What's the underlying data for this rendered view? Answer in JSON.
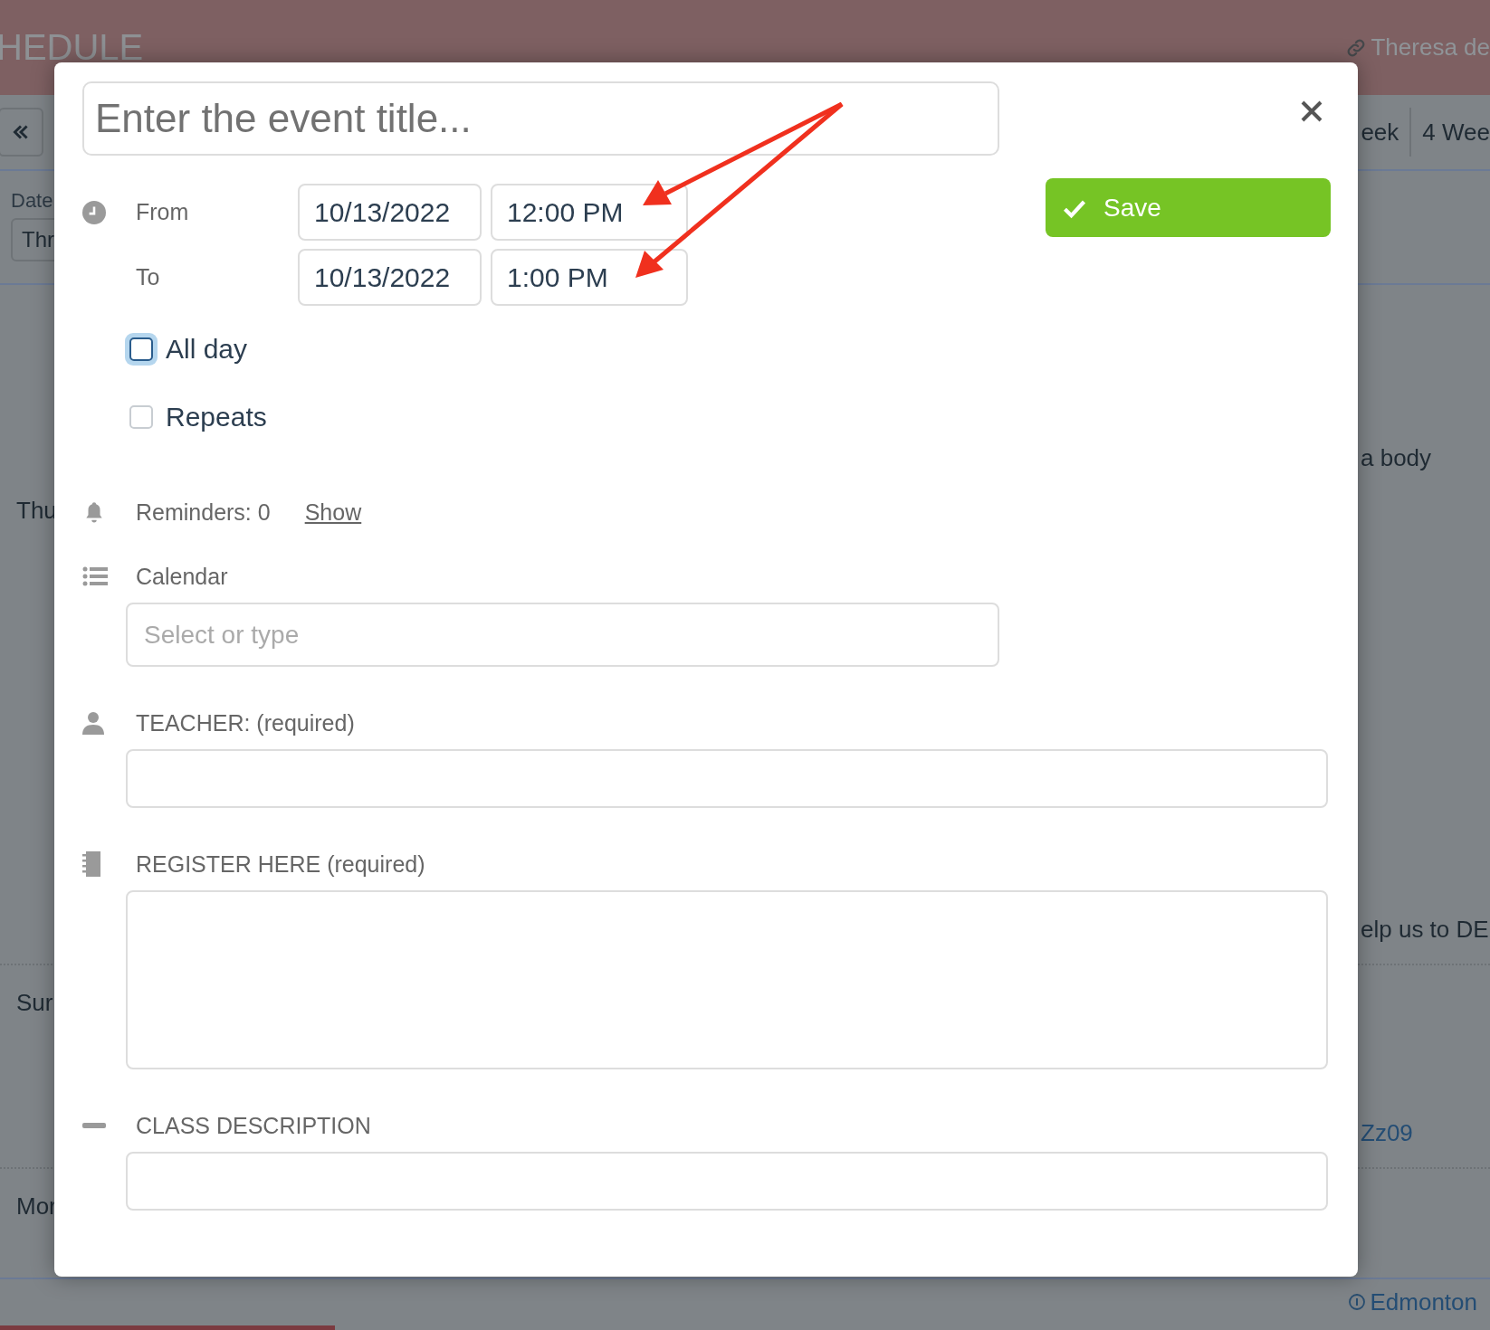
{
  "background": {
    "header_title": "HEDULE",
    "user": "Theresa de",
    "view_tabs": [
      "eek",
      "4 Wee"
    ],
    "date_label": "Date",
    "date_select": "Thr",
    "rows": [
      {
        "day": "Thu",
        "texts": [
          "a body",
          "elp us to DE"
        ],
        "link": ""
      },
      {
        "day": "Sur",
        "texts": [],
        "link": "Zz09"
      },
      {
        "day": "Mor",
        "texts": [],
        "link": ""
      }
    ],
    "timezone": "Edmonton"
  },
  "dialog": {
    "title_placeholder": "Enter the event title...",
    "times": [
      {
        "label": "From",
        "date": "10/13/2022",
        "time": "12:00 PM"
      },
      {
        "label": "To",
        "date": "10/13/2022",
        "time": "1:00 PM"
      }
    ],
    "options": [
      {
        "label": "All day",
        "checked": false,
        "focused": true
      },
      {
        "label": "Repeats",
        "checked": false,
        "focused": false
      }
    ],
    "save": {
      "label": "Save"
    },
    "reminders": {
      "text": "Reminders: 0",
      "link": "Show"
    },
    "sections": [
      {
        "kind": "select",
        "label": "Calendar",
        "placeholder": "Select or type"
      },
      {
        "kind": "input",
        "label": "TEACHER: (required)"
      },
      {
        "kind": "textarea",
        "label": "REGISTER HERE (required)"
      },
      {
        "kind": "input",
        "label": "CLASS DESCRIPTION"
      }
    ]
  }
}
